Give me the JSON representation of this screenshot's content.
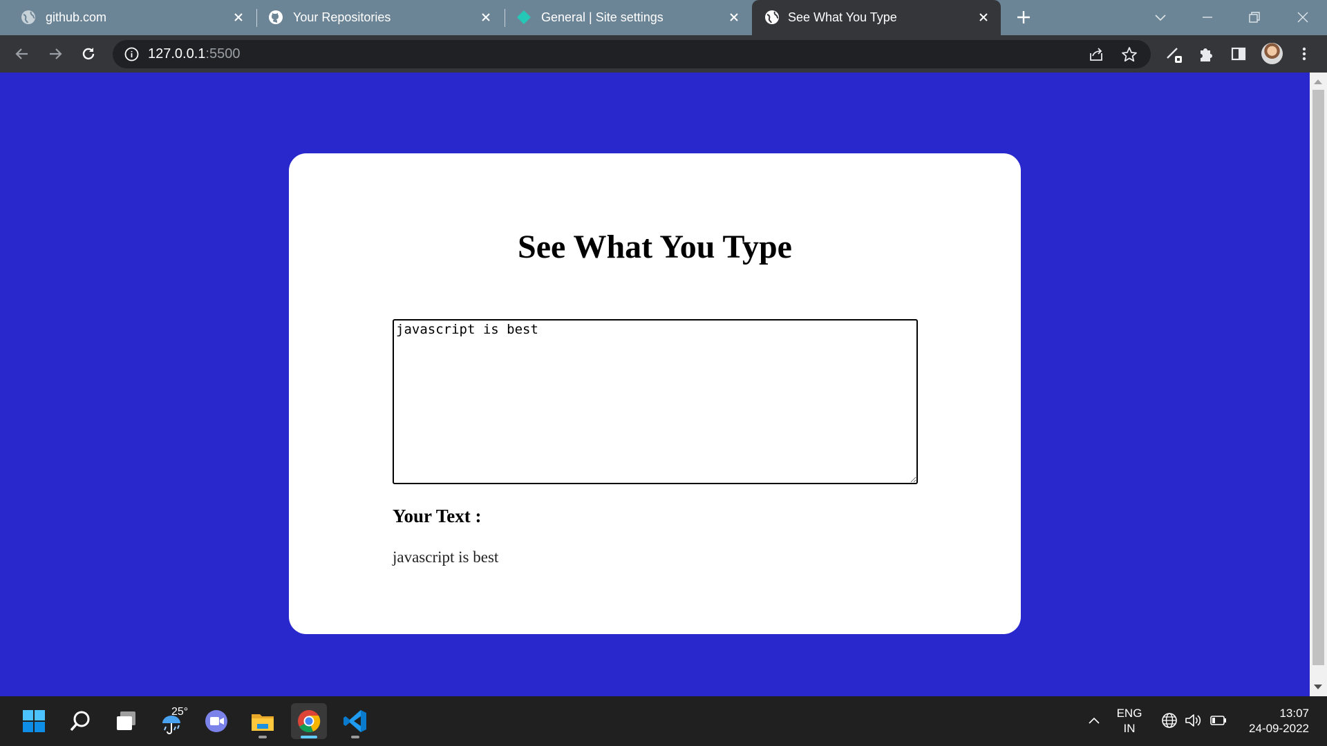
{
  "browser": {
    "tabs": [
      {
        "title": "github.com",
        "icon": "globe-icon",
        "active": false
      },
      {
        "title": "Your Repositories",
        "icon": "github-icon",
        "active": false
      },
      {
        "title": "General | Site settings",
        "icon": "netlify-icon",
        "active": false
      },
      {
        "title": "See What You Type",
        "icon": "globe-icon",
        "active": true
      }
    ],
    "address": {
      "host": "127.0.0.1",
      "port": ":5500"
    }
  },
  "page": {
    "title": "See What You Type",
    "textarea_value": "javascript is best",
    "output_label": "Your Text :",
    "output_text": "javascript is best",
    "background_color": "#2828cc"
  },
  "taskbar": {
    "weather_temp": "25°",
    "lang_top": "ENG",
    "lang_bottom": "IN",
    "time": "13:07",
    "date": "24-09-2022",
    "apps": [
      "start-icon",
      "search-icon",
      "task-view-icon",
      "weather-icon",
      "teams-chat-icon",
      "file-explorer-icon",
      "chrome-icon",
      "vscode-icon"
    ]
  }
}
